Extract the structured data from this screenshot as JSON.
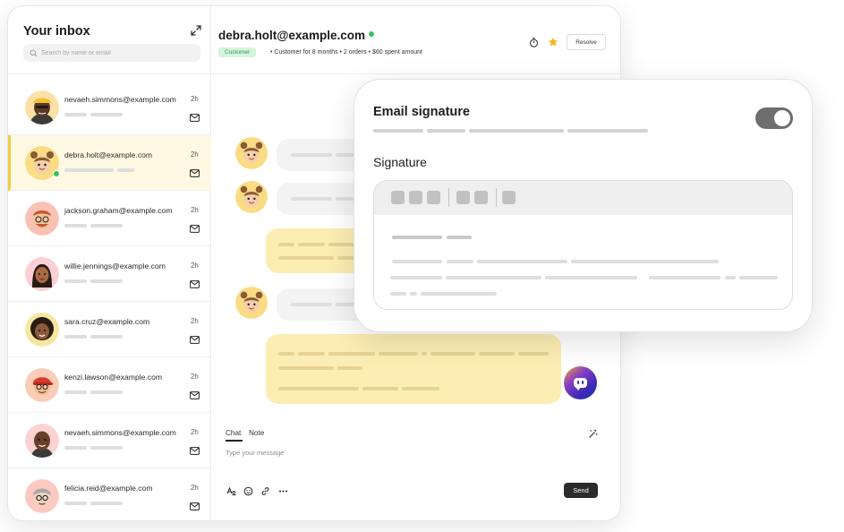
{
  "inbox": {
    "title": "Your inbox",
    "search_placeholder": "Search by name or email",
    "conversations": [
      {
        "email": "nevaeh.simmons@example.com",
        "time": "2h",
        "avatar": "avatar-yellow-cap",
        "active": false
      },
      {
        "email": "debra.holt@example.com",
        "time": "2h",
        "avatar": "avatar-buns",
        "active": true,
        "online": true
      },
      {
        "email": "jackson.graham@example.com",
        "time": "2h",
        "avatar": "avatar-redhead-glasses",
        "active": false
      },
      {
        "email": "willie.jennings@example.com",
        "time": "2h",
        "avatar": "avatar-long-hair",
        "active": false
      },
      {
        "email": "sara.cruz@example.com",
        "time": "2h",
        "avatar": "avatar-curly",
        "active": false
      },
      {
        "email": "kenzi.lawson@example.com",
        "time": "2h",
        "avatar": "avatar-red-cap",
        "active": false
      },
      {
        "email": "nevaeh.simmons@example.com",
        "time": "2h",
        "avatar": "avatar-bald",
        "active": false
      },
      {
        "email": "felicia.reid@example.com",
        "time": "2h",
        "avatar": "avatar-grey-hair",
        "active": false
      }
    ]
  },
  "chat": {
    "contact_email": "debra.holt@example.com",
    "status": "online",
    "badge": "Customer",
    "meta": "•  Customer for 8 months  •  2 orders  •  $60 spent amount",
    "resolve_label": "Resolve",
    "composer": {
      "tabs": [
        "Chat",
        "Note"
      ],
      "active_tab": "Chat",
      "placeholder": "Type your message",
      "send_label": "Send"
    }
  },
  "signature_card": {
    "title": "Email signature",
    "toggle_on": true,
    "field_label": "Signature"
  },
  "colors": {
    "active_row": "#fff9e3",
    "accent_yellow": "#f4cd3f",
    "customer_bubble": "#f3f3f3",
    "agent_bubble": "#fcedb3",
    "online": "#38c25a",
    "badge_bg": "#d7f4dd",
    "badge_text": "#2c9b4b"
  }
}
